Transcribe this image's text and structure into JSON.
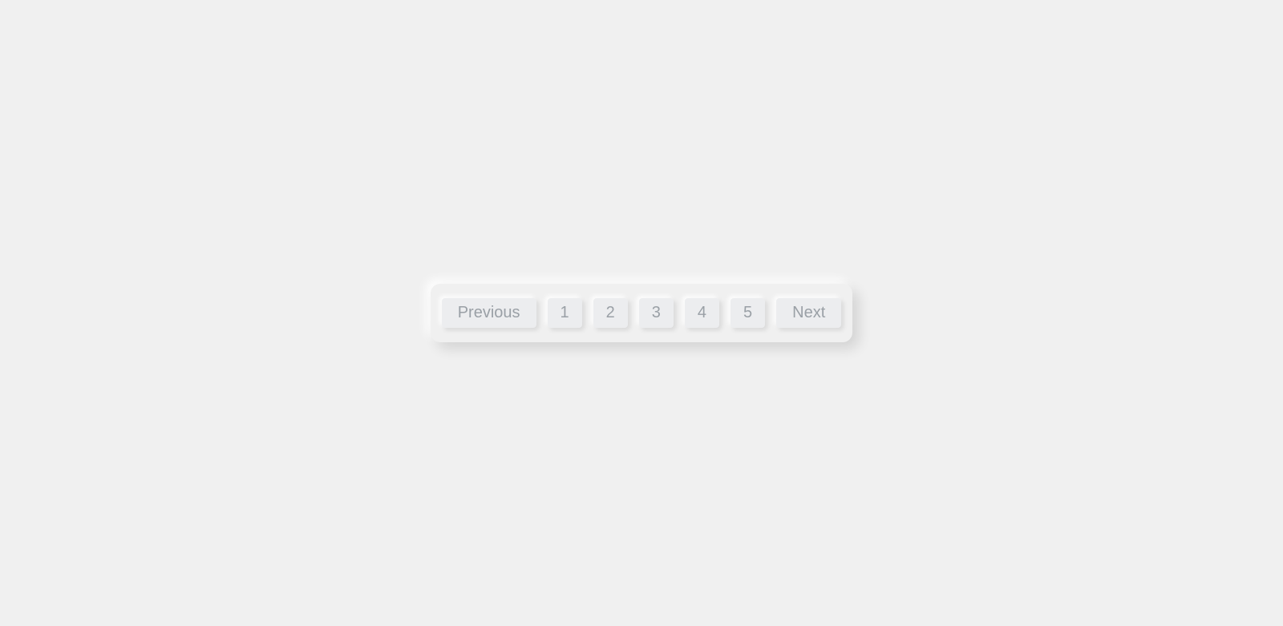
{
  "pagination": {
    "previous_label": "Previous",
    "next_label": "Next",
    "pages": [
      "1",
      "2",
      "3",
      "4",
      "5"
    ]
  }
}
